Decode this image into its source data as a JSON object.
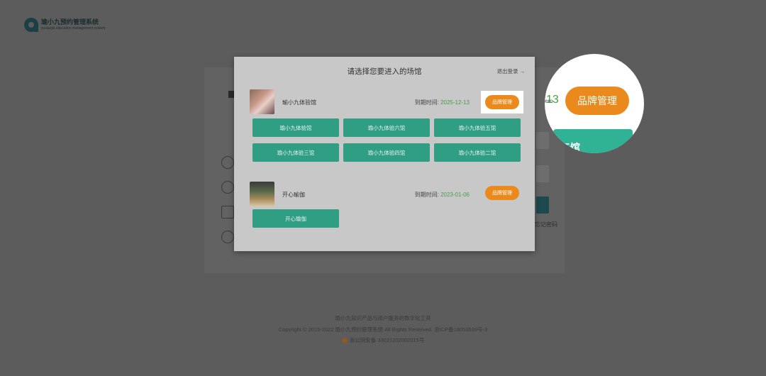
{
  "app": {
    "name_cn": "瑜小九预约管理系统",
    "name_en": "yuxiaojiu education management system"
  },
  "modal": {
    "title": "请选择您要进入的场馆",
    "logout_label": "退出登录",
    "logout_arrow": "→",
    "brands": [
      {
        "name": "瑜小九体验馆",
        "expiry_label": "到期时间:",
        "expiry_date": "2025-12-13",
        "manage_label": "品牌管理",
        "halls": [
          "瑜小九体验馆",
          "瑜小九体验六馆",
          "瑜小九体验五馆",
          "瑜小九体验三馆",
          "瑜小九体验四馆",
          "瑜小九体验二馆"
        ]
      },
      {
        "name": "开心瑜伽",
        "expiry_label": "到期时间:",
        "expiry_date": "2023-01-06",
        "manage_label": "品牌管理",
        "halls": [
          "开心瑜伽"
        ]
      }
    ]
  },
  "zoom": {
    "date_fragment": "13",
    "fragment_left": "tem",
    "manage_label": "品牌管理",
    "hall_fragment": "五馆"
  },
  "background": {
    "forgot_password": "忘记密码"
  },
  "footer": {
    "line1": "瑜小九知识产品与用户服务的数字化工具",
    "line2": "Copyright © 2015-2022 瑜小九预约管理系统 All Rights Reserved. 浙ICP备18053539号-3",
    "line3": "浙公网安备 33021202002015号"
  },
  "colors": {
    "accent_orange": "#ea8a1c",
    "hall_teal": "#2f9e83",
    "date_green": "#43a047"
  }
}
